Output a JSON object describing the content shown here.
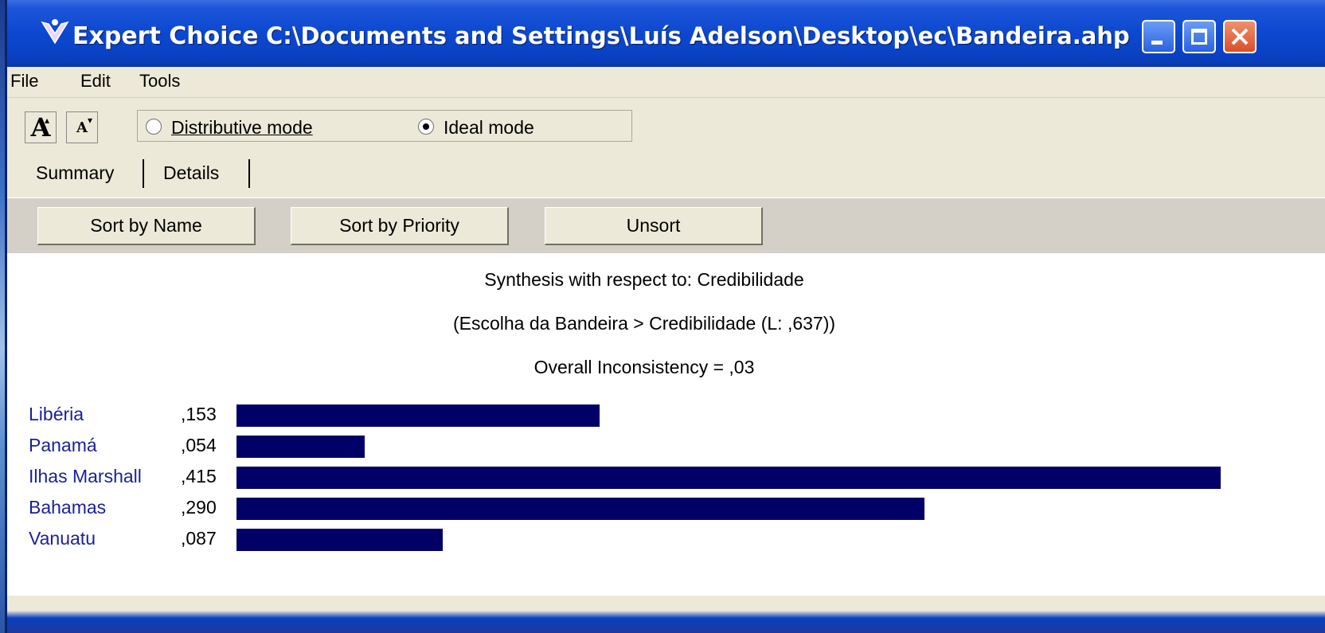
{
  "window": {
    "app_name": "Expert Choice",
    "file_path": "C:\\Documents and Settings\\Luís Adelson\\Desktop\\ec\\Bandeira.ahp"
  },
  "menu": [
    "File",
    "Edit",
    "Tools"
  ],
  "toolbar": {
    "font_increase": "A",
    "font_decrease": "A",
    "modes": [
      {
        "label": "Distributive mode",
        "selected": false
      },
      {
        "label": "Ideal mode",
        "selected": true
      }
    ]
  },
  "tabs": [
    {
      "label": "Summary",
      "active": true
    },
    {
      "label": "Details",
      "active": false
    }
  ],
  "sort_buttons": [
    "Sort by Name",
    "Sort by Priority",
    "Unsort"
  ],
  "synthesis": {
    "title": "Synthesis with respect to: Credibilidade",
    "path": "(Escolha da Bandeira > Credibilidade (L: ,637))",
    "inconsistency": "Overall Inconsistency = ,03"
  },
  "bar_color": "#000066",
  "chart_data": {
    "type": "bar",
    "categories": [
      "Libéria",
      "Panamá",
      "Ilhas Marshall",
      "Bahamas",
      "Vanuatu"
    ],
    "value_labels": [
      ",153",
      ",054",
      ",415",
      ",290",
      ",087"
    ],
    "values": [
      0.153,
      0.054,
      0.415,
      0.29,
      0.087
    ]
  }
}
